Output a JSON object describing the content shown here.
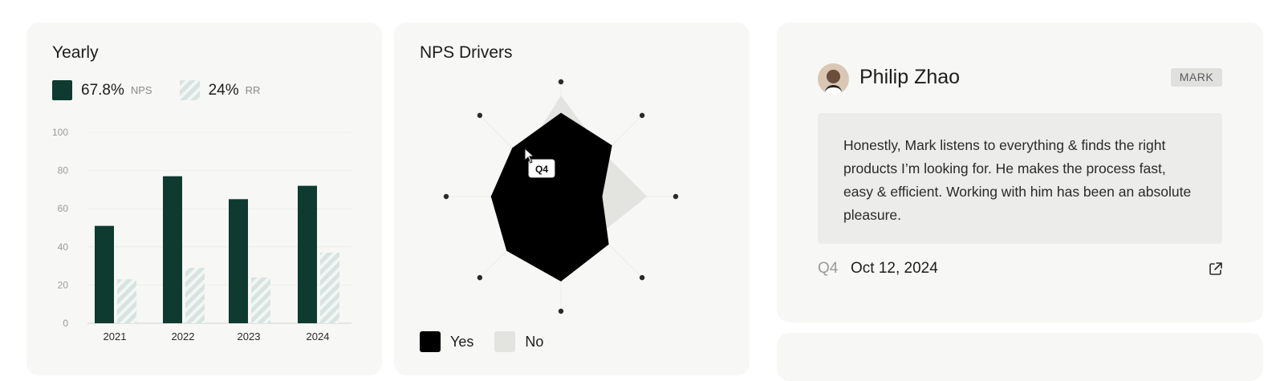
{
  "yearly": {
    "title": "Yearly",
    "legend": [
      {
        "value": "67.8%",
        "label": "NPS"
      },
      {
        "value": "24%",
        "label": "RR"
      }
    ]
  },
  "drivers": {
    "title": "NPS Drivers",
    "tooltip": "Q4",
    "legend": [
      {
        "label": "Yes",
        "color": "#000000"
      },
      {
        "label": "No",
        "color": "#e3e4df"
      }
    ]
  },
  "review": {
    "name": "Philip Zhao",
    "badge": "MARK",
    "text": "Honestly, Mark listens to everything & finds the right products I’m looking for. He makes the process fast, easy & efficient. Working with him has been an absolute pleasure.",
    "quarter": "Q4",
    "date": "Oct 12, 2024",
    "link_icon": "external-link-icon"
  },
  "colors": {
    "nps": "#0e3a2f",
    "rr": "#d7e3e0",
    "card": "#f7f7f5"
  },
  "chart_data": [
    {
      "type": "bar",
      "categories": [
        "2021",
        "2022",
        "2023",
        "2024"
      ],
      "series": [
        {
          "name": "NPS",
          "values": [
            51,
            77,
            65,
            72
          ]
        },
        {
          "name": "RR",
          "values": [
            23,
            29,
            24,
            37
          ]
        }
      ],
      "yticks": [
        0,
        20,
        40,
        60,
        80,
        100
      ],
      "ylim": [
        0,
        100
      ],
      "grid": true
    },
    {
      "type": "radar",
      "axes": 8,
      "rmax": 100,
      "series": [
        {
          "name": "Yes",
          "values": [
            73,
            63,
            36,
            59,
            74,
            67,
            61,
            60
          ]
        },
        {
          "name": "No",
          "values": [
            88,
            53,
            75,
            47,
            64,
            45,
            62,
            48
          ]
        }
      ]
    }
  ]
}
